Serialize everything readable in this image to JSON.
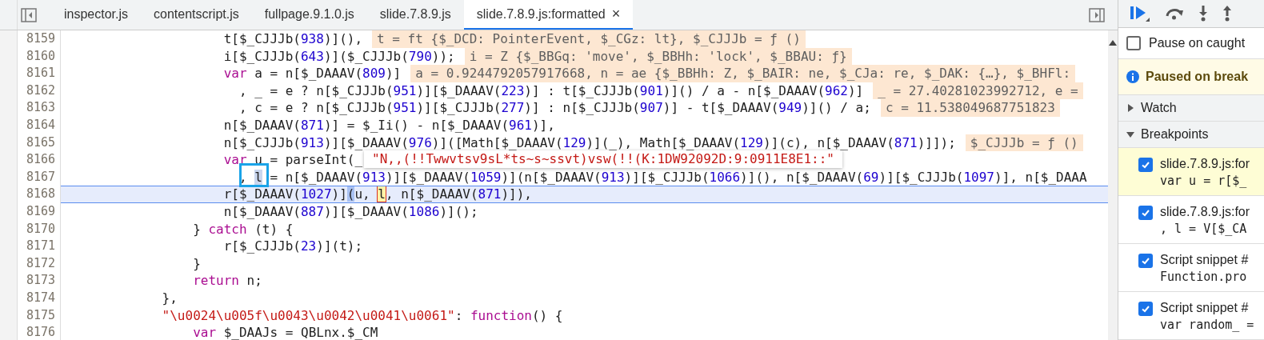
{
  "tabs": [
    {
      "label": "inspector.js",
      "selected": false
    },
    {
      "label": "contentscript.js",
      "selected": false
    },
    {
      "label": "fullpage.9.1.0.js",
      "selected": false
    },
    {
      "label": "slide.7.8.9.js",
      "selected": false
    },
    {
      "label": "slide.7.8.9.js:formatted",
      "selected": true,
      "close": "×"
    }
  ],
  "code": {
    "lines": [
      {
        "number": "8159",
        "current": false,
        "segments": [
          {
            "kind": "plain",
            "text": "                    t[$_CJJJb("
          },
          {
            "kind": "number",
            "text": "938"
          },
          {
            "kind": "plain",
            "text": ")](),"
          }
        ],
        "value": "t = ft {$_DCD: PointerEvent, $_CGz: lt}, $_CJJJb = ƒ ()"
      },
      {
        "number": "8160",
        "current": false,
        "segments": [
          {
            "kind": "plain",
            "text": "                    i[$_CJJJb("
          },
          {
            "kind": "number",
            "text": "643"
          },
          {
            "kind": "plain",
            "text": ")]($_CJJJb("
          },
          {
            "kind": "number",
            "text": "790"
          },
          {
            "kind": "plain",
            "text": "));"
          }
        ],
        "value": "i = Z {$_BBGq: 'move', $_BBHh: 'lock', $_BBAU: ƒ}"
      },
      {
        "number": "8161",
        "current": false,
        "segments": [
          {
            "kind": "keyword",
            "text": "                    var"
          },
          {
            "kind": "plain",
            "text": " a = n[$_DAAAV("
          },
          {
            "kind": "number",
            "text": "809"
          },
          {
            "kind": "plain",
            "text": ")]"
          }
        ],
        "value": "a = 0.9244792057917668, n = ae {$_BBHh: Z, $_BAIR: ne, $_CJa: re, $_DAK: {…}, $_BHFl:"
      },
      {
        "number": "8162",
        "current": false,
        "segments": [
          {
            "kind": "plain",
            "text": "                      , _ = e ? n[$_CJJJb("
          },
          {
            "kind": "number",
            "text": "951"
          },
          {
            "kind": "plain",
            "text": ")][$_DAAAV("
          },
          {
            "kind": "number",
            "text": "223"
          },
          {
            "kind": "plain",
            "text": ")] : t[$_CJJJb("
          },
          {
            "kind": "number",
            "text": "901"
          },
          {
            "kind": "plain",
            "text": ")]() / a - n[$_DAAAV("
          },
          {
            "kind": "number",
            "text": "962"
          },
          {
            "kind": "plain",
            "text": ")]"
          }
        ],
        "value": "_ = 27.40281023992712, e ="
      },
      {
        "number": "8163",
        "current": false,
        "segments": [
          {
            "kind": "plain",
            "text": "                      , c = e ? n[$_CJJJb("
          },
          {
            "kind": "number",
            "text": "951"
          },
          {
            "kind": "plain",
            "text": ")][$_CJJJb("
          },
          {
            "kind": "number",
            "text": "277"
          },
          {
            "kind": "plain",
            "text": ")] : n[$_CJJJb("
          },
          {
            "kind": "number",
            "text": "907"
          },
          {
            "kind": "plain",
            "text": ")] - t[$_DAAAV("
          },
          {
            "kind": "number",
            "text": "949"
          },
          {
            "kind": "plain",
            "text": ")]() / a;"
          }
        ],
        "value": "c = 11.538049687751823"
      },
      {
        "number": "8164",
        "current": false,
        "segments": [
          {
            "kind": "plain",
            "text": "                    n[$_DAAAV("
          },
          {
            "kind": "number",
            "text": "871"
          },
          {
            "kind": "plain",
            "text": ")] = $_Ii() - n[$_DAAAV("
          },
          {
            "kind": "number",
            "text": "961"
          },
          {
            "kind": "plain",
            "text": ")],"
          }
        ]
      },
      {
        "number": "8165",
        "current": false,
        "segments": [
          {
            "kind": "plain",
            "text": "                    n[$_CJJJb("
          },
          {
            "kind": "number",
            "text": "913"
          },
          {
            "kind": "plain",
            "text": ")][$_DAAAV("
          },
          {
            "kind": "number",
            "text": "976"
          },
          {
            "kind": "plain",
            "text": ")]([Math[$_DAAAV("
          },
          {
            "kind": "number",
            "text": "129"
          },
          {
            "kind": "plain",
            "text": ")](_), Math[$_DAAAV("
          },
          {
            "kind": "number",
            "text": "129"
          },
          {
            "kind": "plain",
            "text": ")](c), n[$_DAAAV("
          },
          {
            "kind": "number",
            "text": "871"
          },
          {
            "kind": "plain",
            "text": ")]]);"
          }
        ],
        "value": "$_CJJJb = ƒ ()"
      },
      {
        "number": "8166",
        "current": false,
        "segments": [
          {
            "kind": "keyword",
            "text": "                    var"
          },
          {
            "kind": "plain",
            "text": " u = parseInt(_"
          }
        ]
      },
      {
        "number": "8167",
        "current": false,
        "segments": [
          {
            "kind": "plain",
            "text": "                      , "
          },
          {
            "kind": "selection",
            "text": "l"
          },
          {
            "kind": "plain",
            "text": " = n[$_DAAAV("
          },
          {
            "kind": "number",
            "text": "913"
          },
          {
            "kind": "plain",
            "text": ")][$_DAAAV("
          },
          {
            "kind": "number",
            "text": "1059"
          },
          {
            "kind": "plain",
            "text": ")](n[$_DAAAV("
          },
          {
            "kind": "number",
            "text": "913"
          },
          {
            "kind": "plain",
            "text": ")][$_CJJJb("
          },
          {
            "kind": "number",
            "text": "1066"
          },
          {
            "kind": "plain",
            "text": ")](), n[$_DAAAV("
          },
          {
            "kind": "number",
            "text": "69"
          },
          {
            "kind": "plain",
            "text": ")][$_CJJJb("
          },
          {
            "kind": "number",
            "text": "1097"
          },
          {
            "kind": "plain",
            "text": ")], n[$_DAAA"
          }
        ]
      },
      {
        "number": "8168",
        "current": true,
        "segments": [
          {
            "kind": "plain",
            "text": "                    r[$_DAAAV("
          },
          {
            "kind": "number",
            "text": "1027"
          },
          {
            "kind": "plain",
            "text": ")]"
          },
          {
            "kind": "paren",
            "text": "("
          },
          {
            "kind": "plain",
            "text": "u, "
          },
          {
            "kind": "hover",
            "text": "l"
          },
          {
            "kind": "plain",
            "text": ", n[$_DAAAV("
          },
          {
            "kind": "number",
            "text": "871"
          },
          {
            "kind": "plain",
            "text": ")]),"
          }
        ]
      },
      {
        "number": "8169",
        "current": false,
        "segments": [
          {
            "kind": "plain",
            "text": "                    n[$_DAAAV("
          },
          {
            "kind": "number",
            "text": "887"
          },
          {
            "kind": "plain",
            "text": ")][$_DAAAV("
          },
          {
            "kind": "number",
            "text": "1086"
          },
          {
            "kind": "plain",
            "text": ")]();"
          }
        ]
      },
      {
        "number": "8170",
        "current": false,
        "segments": [
          {
            "kind": "plain",
            "text": "                } "
          },
          {
            "kind": "keyword",
            "text": "catch"
          },
          {
            "kind": "plain",
            "text": " (t) {"
          }
        ]
      },
      {
        "number": "8171",
        "current": false,
        "segments": [
          {
            "kind": "plain",
            "text": "                    r[$_CJJJb("
          },
          {
            "kind": "number",
            "text": "23"
          },
          {
            "kind": "plain",
            "text": ")](t);"
          }
        ]
      },
      {
        "number": "8172",
        "current": false,
        "segments": [
          {
            "kind": "plain",
            "text": "                }"
          }
        ]
      },
      {
        "number": "8173",
        "current": false,
        "segments": [
          {
            "kind": "keyword",
            "text": "                return"
          },
          {
            "kind": "plain",
            "text": " n;"
          }
        ]
      },
      {
        "number": "8174",
        "current": false,
        "segments": [
          {
            "kind": "plain",
            "text": "            },"
          }
        ]
      },
      {
        "number": "8175",
        "current": false,
        "segments": [
          {
            "kind": "string",
            "text": "            \"\\u0024\\u005f\\u0043\\u0042\\u0041\\u0061\""
          },
          {
            "kind": "plain",
            "text": ": "
          },
          {
            "kind": "keyword",
            "text": "function"
          },
          {
            "kind": "plain",
            "text": "() {"
          }
        ]
      },
      {
        "number": "8176",
        "current": false,
        "segments": [
          {
            "kind": "keyword",
            "text": "                var"
          },
          {
            "kind": "plain",
            "text": " $_DAAJs = QBLnx.$_CM"
          }
        ]
      }
    ],
    "tooltip": "\"N,,(!!Twwvtsv9sL*ts~s~ssvt)vsw(!!(K:1DW92092D:9:0911E8E1::\""
  },
  "debugger": {
    "pause_on_caught": {
      "label": "Pause on caught",
      "checked": false
    },
    "paused_banner": "Paused on break",
    "sections": [
      {
        "title": "Watch",
        "expanded": false
      },
      {
        "title": "Breakpoints",
        "expanded": true
      }
    ],
    "breakpoints": [
      {
        "file": "slide.7.8.9.js:for",
        "code": "var u = r[$_",
        "checked": true,
        "selected": true
      },
      {
        "file": "slide.7.8.9.js:for",
        "code": ", l = V[$_CA",
        "checked": true,
        "selected": false
      },
      {
        "file": "Script snippet #",
        "code": "Function.pro",
        "checked": true,
        "selected": false
      },
      {
        "file": "Script snippet #",
        "code": "var random_ =",
        "checked": true,
        "selected": false
      }
    ]
  }
}
